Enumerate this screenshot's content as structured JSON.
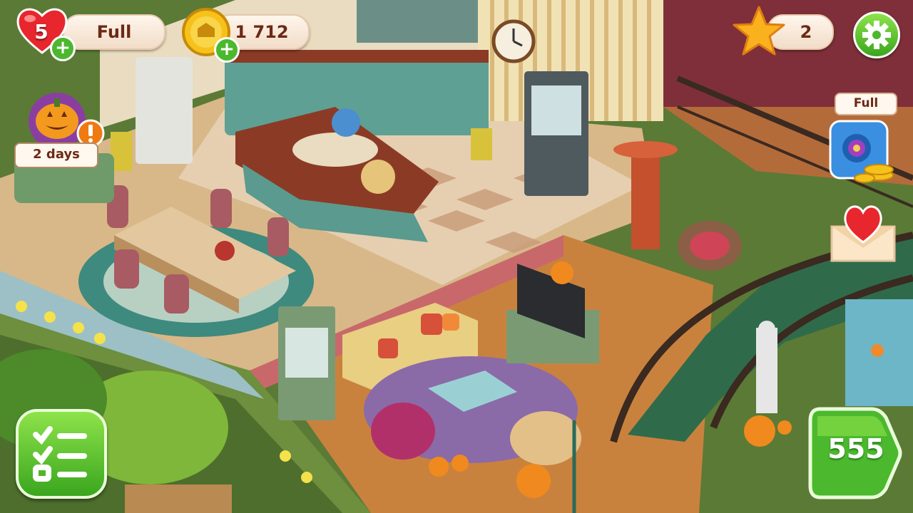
{
  "hud": {
    "lives": {
      "count": "5",
      "status": "Full",
      "icon": "heart-icon"
    },
    "coins": {
      "amount": "1 712",
      "icon": "coin-icon"
    },
    "stars": {
      "amount": "2",
      "icon": "star-icon"
    },
    "settings_icon": "gear-icon"
  },
  "event": {
    "timer": "2 days",
    "icon": "pumpkin-event-icon"
  },
  "piggy_bank": {
    "status": "Full",
    "icon": "piggy-bank-icon"
  },
  "mail_icon": "heart-envelope-icon",
  "tasks_icon": "task-list-icon",
  "play_button": {
    "level": "555"
  },
  "colors": {
    "accent_green": "#4cb82e",
    "text_brown": "#6b2a16",
    "pill_cream": "#fff6ec"
  }
}
